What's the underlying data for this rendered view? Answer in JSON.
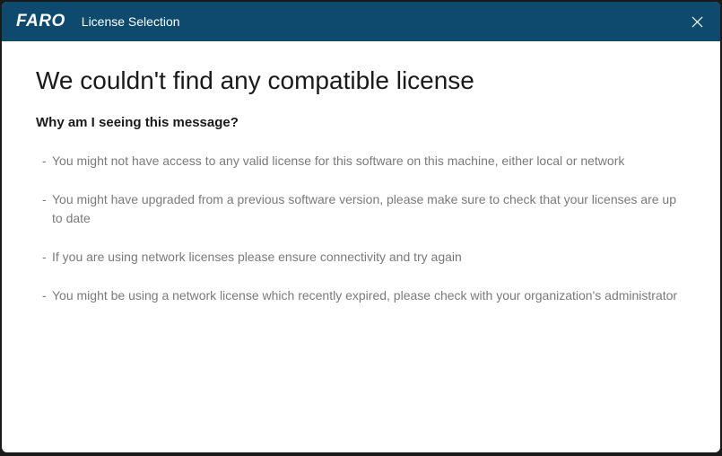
{
  "titlebar": {
    "logo": "FARO",
    "title": "License Selection"
  },
  "content": {
    "heading": "We couldn't find any compatible license",
    "subheading": "Why am I seeing this message?",
    "reasons": [
      "You might not have access to any valid license for this software on this machine, either local or network",
      "You might have upgraded from a previous software version, please make sure to check that your licenses are up to date",
      "If you are using network licenses please ensure connectivity and try again",
      "You might be using a network license which recently expired, please check with your organization's administrator"
    ]
  }
}
